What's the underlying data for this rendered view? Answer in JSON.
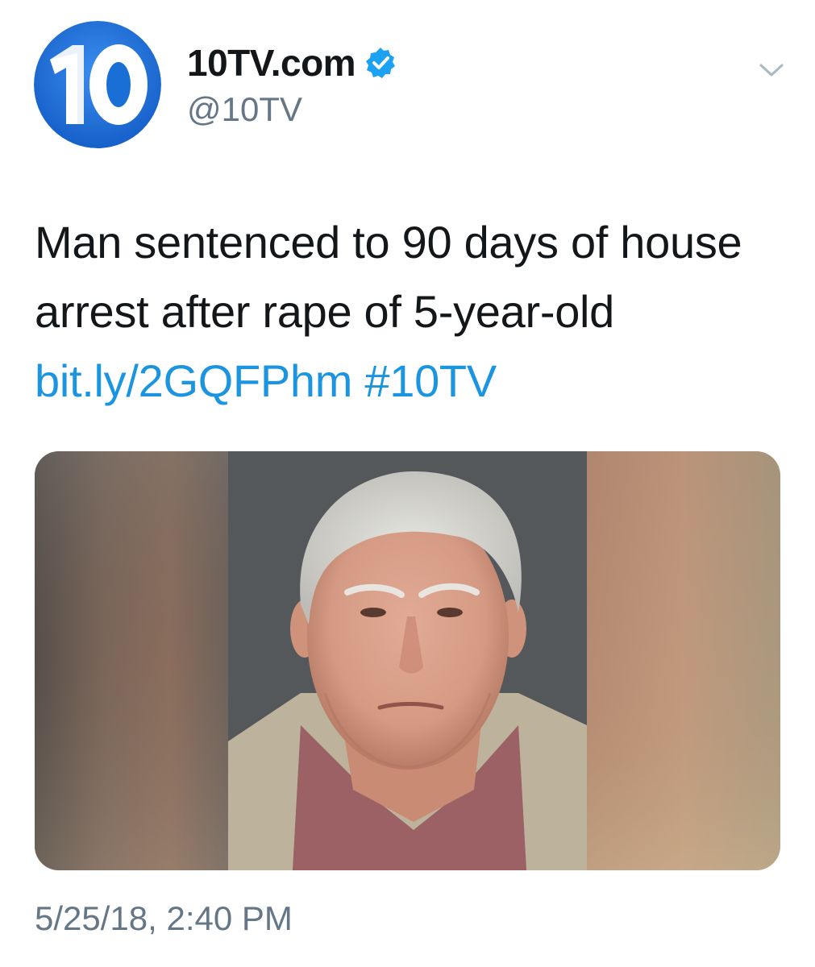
{
  "account": {
    "display_name": "10TV.com",
    "handle": "@10TV",
    "avatar_text": "10",
    "verified_icon": "verified-badge-icon",
    "menu_icon": "chevron-down-icon"
  },
  "tweet": {
    "text": "Man sentenced to 90 days of house arrest after rape of 5-year-old",
    "link": "bit.ly/2GQFPhm",
    "hashtag": "#10TV",
    "timestamp": "5/25/18, 2:40 PM"
  },
  "colors": {
    "link": "#1b95e0",
    "secondary_text": "#657786",
    "verified": "#1da1f2",
    "avatar_blue": "#1a6fd6"
  }
}
